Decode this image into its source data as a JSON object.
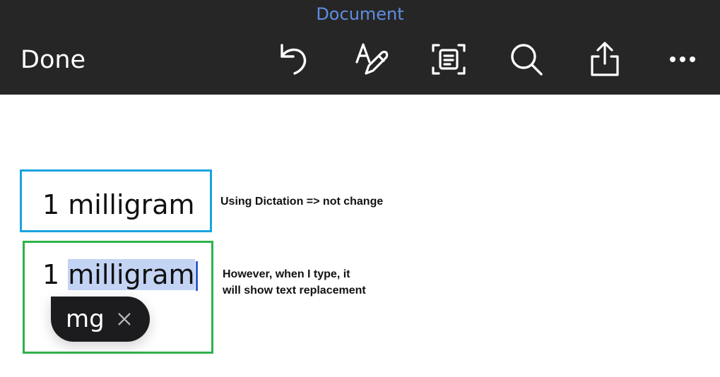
{
  "toolbar": {
    "title": "Document",
    "done_label": "Done",
    "icons": [
      "undo-icon",
      "markup-icon",
      "scan-text-icon",
      "search-icon",
      "share-icon",
      "more-icon"
    ],
    "title_color": "#5f8de0",
    "background": "#262626"
  },
  "document": {
    "dictated": {
      "number": "1",
      "word": "milligram"
    },
    "typed": {
      "number": "1",
      "word": "milligram",
      "selection_color": "#c3d3f4"
    },
    "text_replacement": {
      "suggestion": "mg",
      "dismiss_icon": "close-icon"
    }
  },
  "annotations": {
    "dictation_note": "Using Dictation => not change",
    "typing_note_line1": "However, when I type, it",
    "typing_note_line2": "will show text replacement",
    "dictation_box_color": "#1aa3e0",
    "typing_box_color": "#2fb24a"
  }
}
